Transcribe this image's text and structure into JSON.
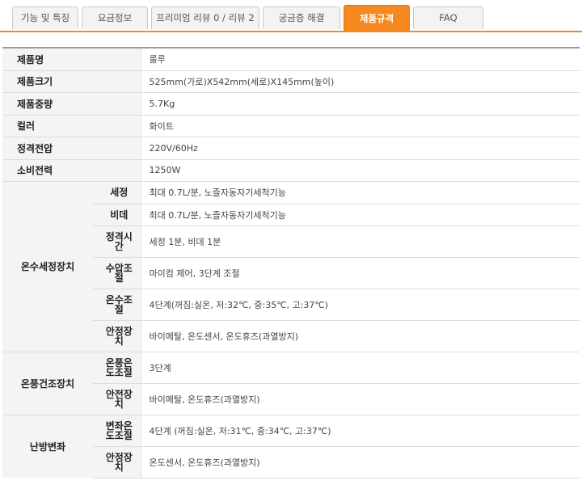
{
  "tabs": [
    {
      "label": "기능 및 특징",
      "active": false
    },
    {
      "label": "요금정보",
      "active": false
    },
    {
      "label": "프리미엄 리뷰 0 / 리뷰 2",
      "active": false
    },
    {
      "label": "궁금증 해결",
      "active": false
    },
    {
      "label": "제품규격",
      "active": true
    },
    {
      "label": "FAQ",
      "active": false
    }
  ],
  "colors": {
    "accent": "#f5891f",
    "label_bg": "#f4f4f4",
    "border": "#dcdcdc"
  },
  "specs": {
    "product_name": {
      "label": "제품명",
      "value": "룰루"
    },
    "product_size": {
      "label": "제품크기",
      "value": "525mm(가로)X542mm(세로)X145mm(높이)"
    },
    "product_weight": {
      "label": "제품중량",
      "value": "5.7Kg"
    },
    "color": {
      "label": "컬러",
      "value": "화이트"
    },
    "rated_voltage": {
      "label": "정격전압",
      "value": "220V/60Hz"
    },
    "power_consumption": {
      "label": "소비전력",
      "value": "1250W"
    },
    "warm_water_wash": {
      "label": "온수세정장치",
      "rows": [
        {
          "label": "세정",
          "value": "최대 0.7L/분, 노즐자동자기세척기능"
        },
        {
          "label": "비데",
          "value": "최대 0.7L/분, 노즐자동자기세척기능"
        },
        {
          "label": "정격시간",
          "value": "세정 1분, 비데 1분"
        },
        {
          "label": "수압조절",
          "value": "마이컴 제어, 3단계 조절"
        },
        {
          "label": "온수조절",
          "value": "4단계(꺼짐:실온, 저:32℃, 중:35℃, 고:37℃)"
        },
        {
          "label": "안정장치",
          "value": "바이메탈, 온도센서, 온도휴즈(과열방지)"
        }
      ]
    },
    "warm_air_dry": {
      "label": "온풍건조장치",
      "rows": [
        {
          "label": "온풍온도조절",
          "value": "3단계"
        },
        {
          "label": "안전장치",
          "value": "바이메탈, 온도휴즈(과열방지)"
        }
      ]
    },
    "heated_seat": {
      "label": "난방변좌",
      "rows": [
        {
          "label": "변좌온도조절",
          "value": "4단계 (꺼짐:실온, 저:31℃, 중:34℃, 고:37℃)"
        },
        {
          "label": "안정장치",
          "value": "온도센서, 온도휴즈(과열방지)"
        }
      ]
    }
  }
}
